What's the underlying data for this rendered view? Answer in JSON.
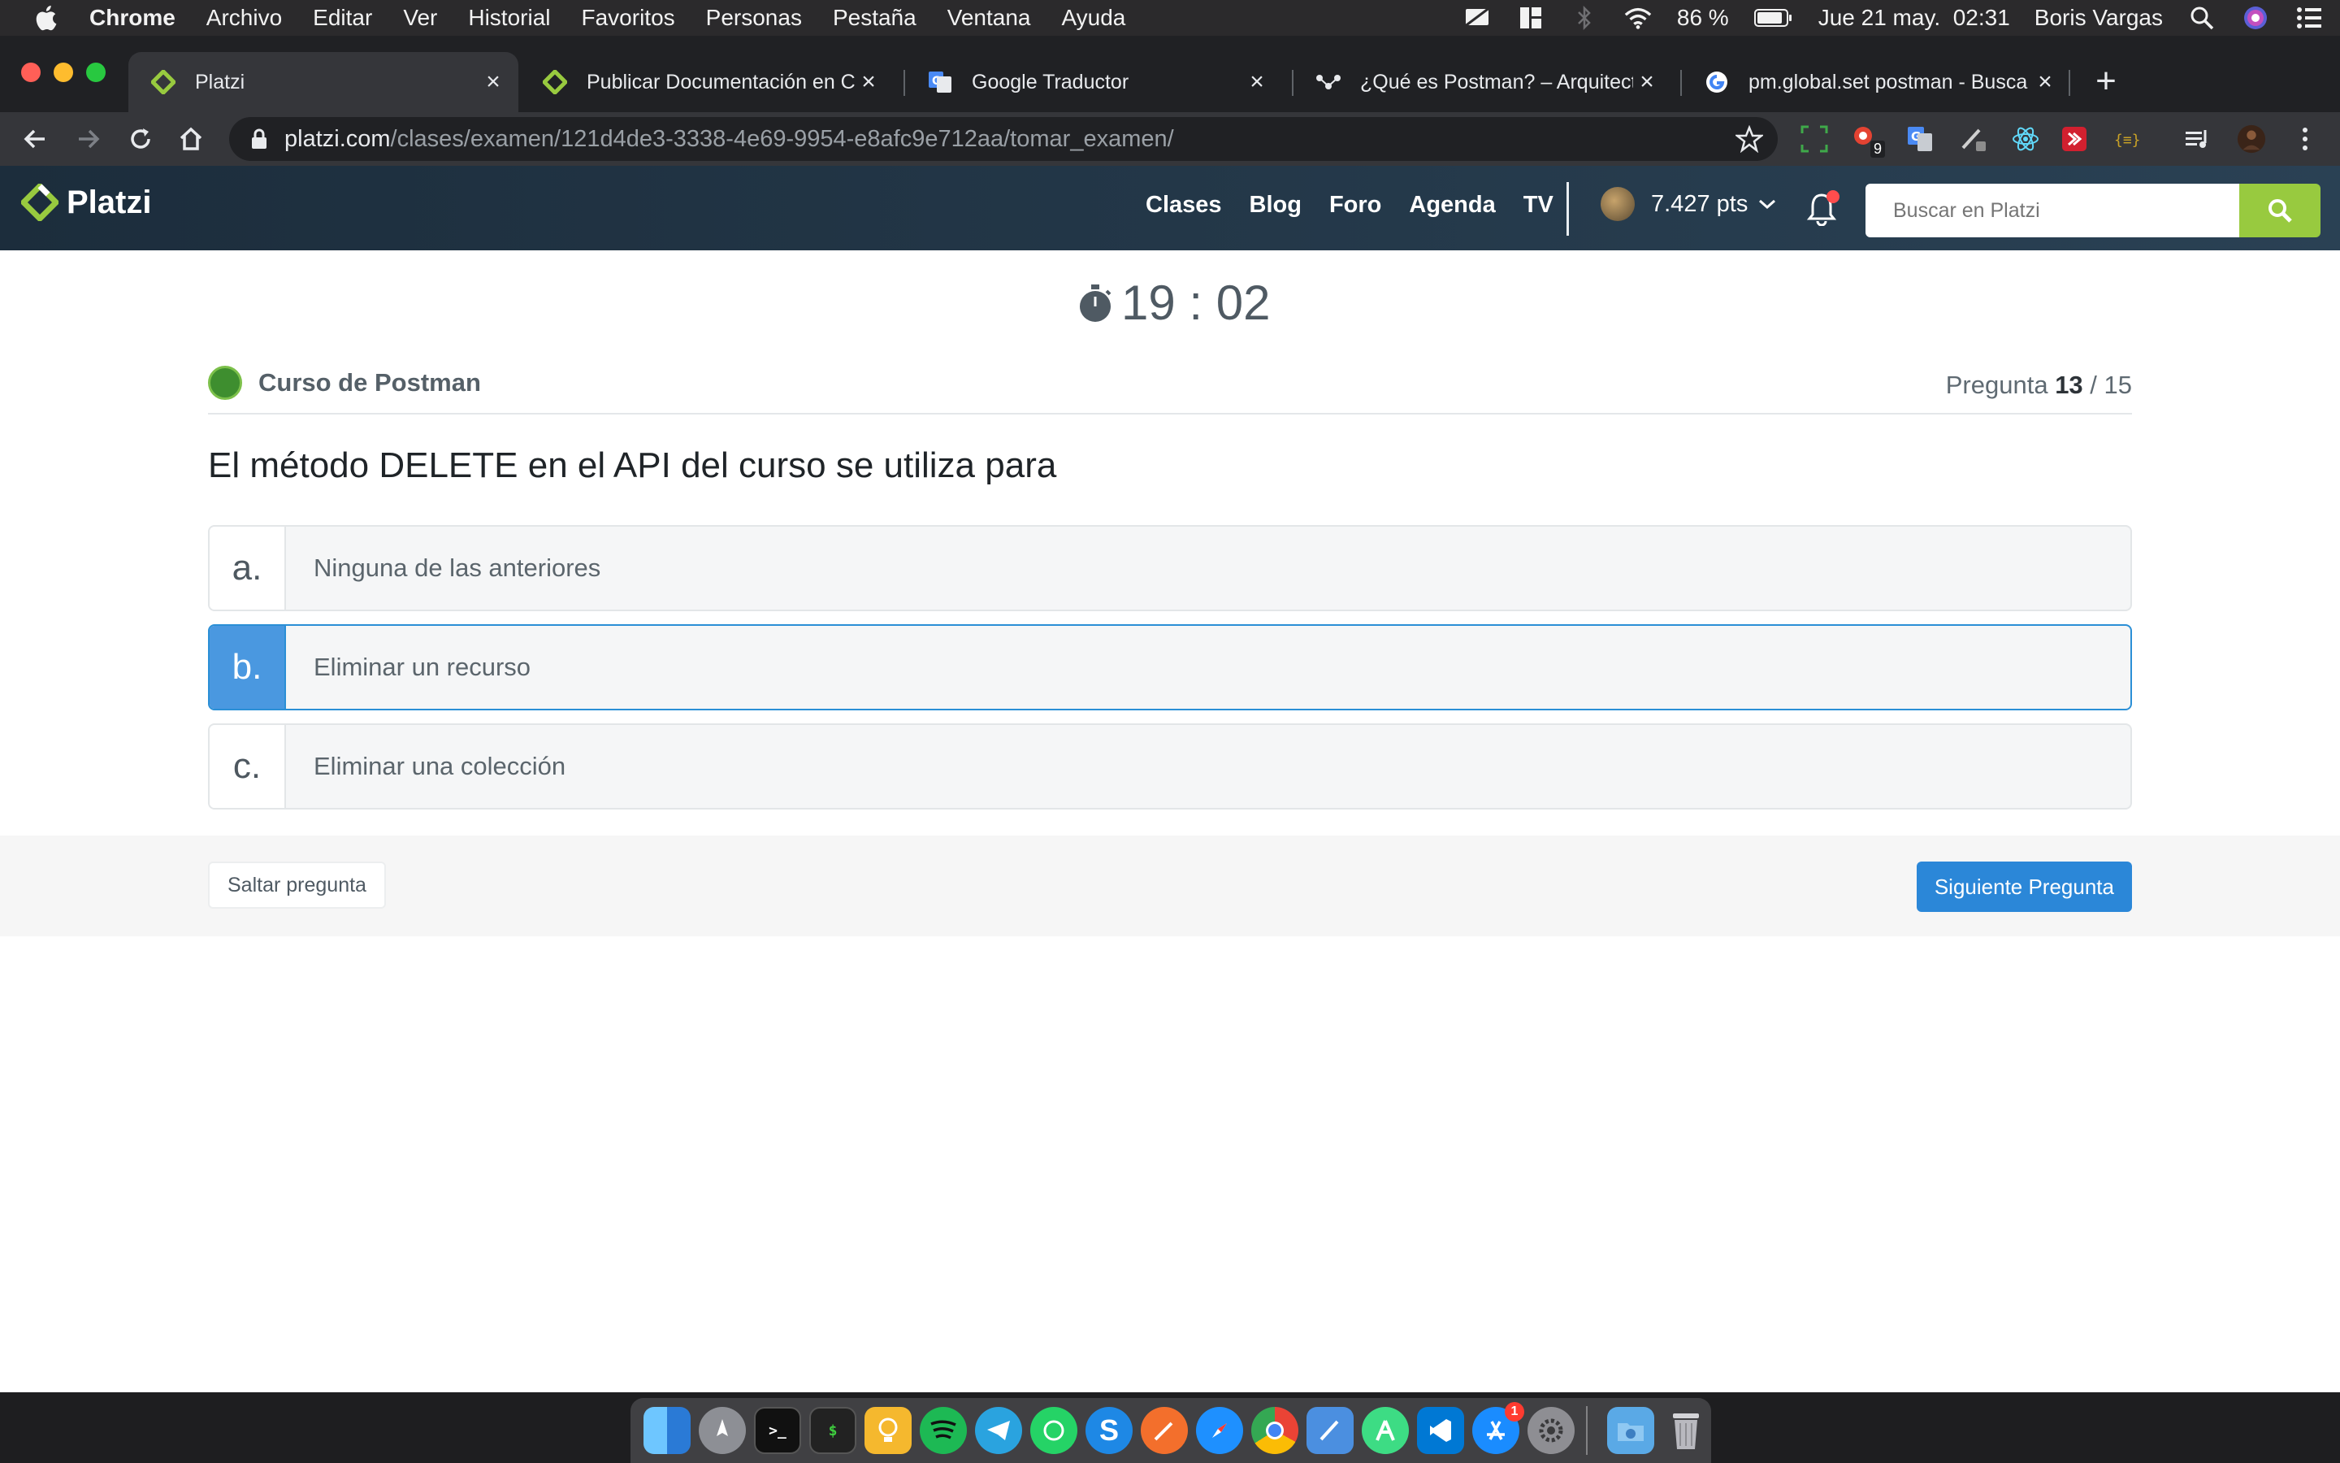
{
  "menubar": {
    "app_name": "Chrome",
    "menu_items": [
      "Archivo",
      "Editar",
      "Ver",
      "Historial",
      "Favoritos",
      "Personas",
      "Pestaña",
      "Ventana",
      "Ayuda"
    ],
    "battery": "86 %",
    "datetime": "Jue 21 may.  02:31",
    "user": "Boris Vargas"
  },
  "tabs": [
    {
      "title": "Platzi",
      "icon": "platzi-icon",
      "active": true
    },
    {
      "title": "Publicar Documentación en Cu",
      "icon": "platzi-icon",
      "active": false
    },
    {
      "title": "Google Traductor",
      "icon": "google-translate-icon",
      "active": false
    },
    {
      "title": "¿Qué es Postman? – Arquitecto",
      "icon": "postman-icon",
      "active": false
    },
    {
      "title": "pm.global.set postman - Busca",
      "icon": "google-icon",
      "active": false
    }
  ],
  "toolbar": {
    "url_host": "platzi.com",
    "url_path": "/clases/examen/121d4de3-3338-4e69-9954-e8afc9e712aa/tomar_examen/",
    "extension_badge": "9"
  },
  "header": {
    "brand": "Platzi",
    "nav": [
      "Clases",
      "Blog",
      "Foro",
      "Agenda",
      "TV"
    ],
    "points": "7.427 pts",
    "search_placeholder": "Buscar en Platzi"
  },
  "exam": {
    "timer": "19 : 02",
    "course": "Curso de Postman",
    "question_prefix": "Pregunta ",
    "question_current": "13",
    "question_total": " / 15",
    "question": "El método DELETE en el API del curso se utiliza para",
    "options": [
      {
        "letter": "a.",
        "text": "Ninguna de las anteriores",
        "selected": false
      },
      {
        "letter": "b.",
        "text": "Eliminar un recurso",
        "selected": true
      },
      {
        "letter": "c.",
        "text": "Eliminar una colección",
        "selected": false
      }
    ],
    "skip_label": "Saltar pregunta",
    "next_label": "Siguiente Pregunta"
  },
  "dock": {
    "appstore_badge": "1"
  }
}
